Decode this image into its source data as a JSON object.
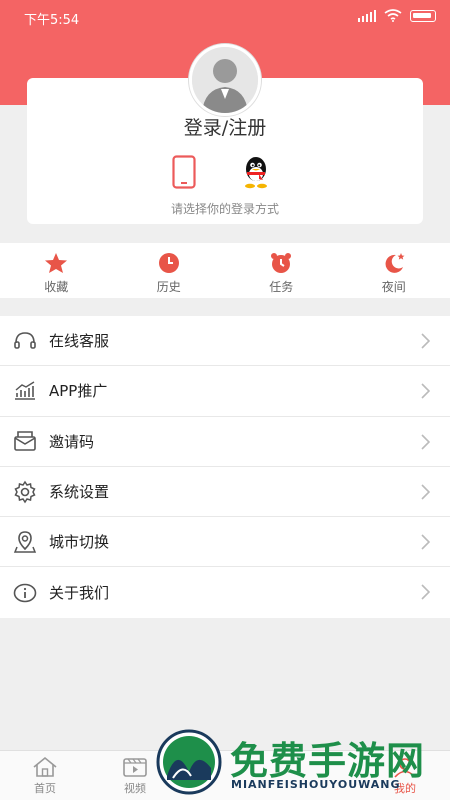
{
  "status_bar": {
    "time": "下午5:54"
  },
  "login": {
    "title": "登录/注册",
    "hint": "请选择你的登录方式",
    "methods": [
      "phone-icon",
      "qq-icon"
    ]
  },
  "quick_actions": [
    {
      "label": "收藏",
      "icon": "star-icon"
    },
    {
      "label": "历史",
      "icon": "clock-icon"
    },
    {
      "label": "任务",
      "icon": "alarm-icon"
    },
    {
      "label": "夜间",
      "icon": "moon-icon"
    }
  ],
  "menu": [
    {
      "label": "在线客服",
      "icon": "headset-icon"
    },
    {
      "label": "APP推广",
      "icon": "chart-icon"
    },
    {
      "label": "邀请码",
      "icon": "envelope-icon"
    },
    {
      "label": "系统设置",
      "icon": "gear-icon"
    },
    {
      "label": "城市切换",
      "icon": "location-icon"
    },
    {
      "label": "关于我们",
      "icon": "info-icon"
    }
  ],
  "tabbar": [
    {
      "label": "首页",
      "icon": "home-icon"
    },
    {
      "label": "视频",
      "icon": "video-icon"
    },
    {
      "label": "",
      "icon": "tab3-icon"
    },
    {
      "label": "",
      "icon": "tab4-icon"
    },
    {
      "label": "我的",
      "icon": "user-icon"
    }
  ],
  "watermark": {
    "title": "免费手游网",
    "subtitle": "MIANFEISHOUYOUWANG"
  },
  "colors": {
    "accent": "#f46464",
    "brand_green": "#1e8f4a"
  }
}
